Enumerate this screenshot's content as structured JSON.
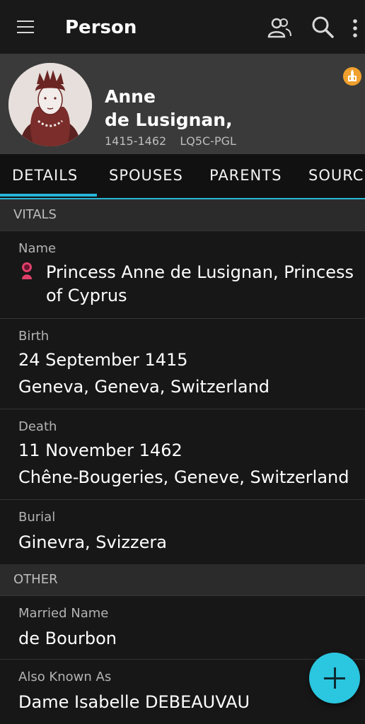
{
  "appbar": {
    "title": "Person",
    "menu_icon": "menu-icon",
    "people_icon": "people-icon",
    "search_icon": "search-icon",
    "more_icon": "more-vertical-icon"
  },
  "person": {
    "given_name": "Anne",
    "surname": "de Lusignan,",
    "lifespan": "1415-1462",
    "pid": "LQ5C-PGL",
    "badge_icon": "temple-icon",
    "badge_color": "#f0a02c"
  },
  "tabs": [
    {
      "label": "DETAILS"
    },
    {
      "label": "SPOUSES"
    },
    {
      "label": "PARENTS"
    },
    {
      "label": "SOURC"
    }
  ],
  "vitals": {
    "heading": "VITALS",
    "name_label": "Name",
    "name_value": "Princess Anne de Lusignan, Princess of Cyprus",
    "gender_icon": "female-icon",
    "birth_label": "Birth",
    "birth_date": "24 September 1415",
    "birth_place": "Geneva, Geneva, Switzerland",
    "death_label": "Death",
    "death_date": "11 November 1462",
    "death_place": "Chêne-Bougeries, Geneve, Switzerland",
    "burial_label": "Burial",
    "burial_place": "Ginevra, Svizzera"
  },
  "other": {
    "heading": "OTHER",
    "married_label": "Married Name",
    "married_value": "de Bourbon",
    "aka_label": "Also Known As",
    "aka_value": "Dame Isabelle DEBEAUVAU"
  },
  "fab": {
    "icon": "plus-icon"
  },
  "colors": {
    "accent": "#27b6d6",
    "fab": "#2bc6e0"
  }
}
